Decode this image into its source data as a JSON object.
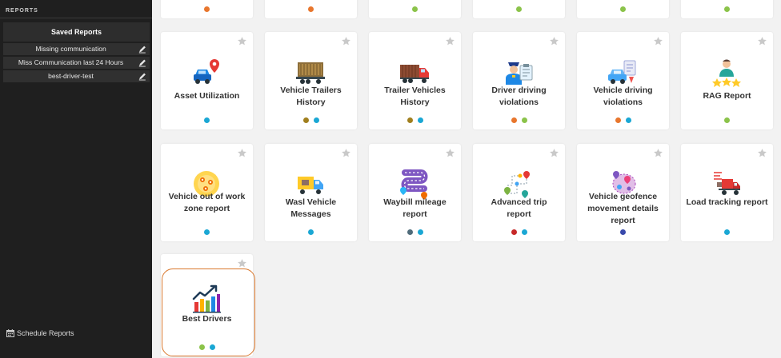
{
  "sidebar": {
    "header": "REPORTS",
    "saved_title": "Saved Reports",
    "saved_items": [
      {
        "label": "Missing communication"
      },
      {
        "label": "Miss Communication last 24 Hours"
      },
      {
        "label": "best-driver-test"
      }
    ],
    "schedule_label": "Schedule Reports"
  },
  "colors": {
    "orange": "#e8762d",
    "green": "#8bc34a",
    "cyan": "#1aa7d4",
    "olive": "#a07f1e",
    "red": "#c62828",
    "slate": "#4f6b7a",
    "navy": "#3949ab",
    "highlight": "#d9772c"
  },
  "reports": [
    {
      "title": "",
      "icon": "none",
      "dots": [
        "orange"
      ]
    },
    {
      "title": "",
      "icon": "none",
      "dots": [
        "orange"
      ]
    },
    {
      "title": "",
      "icon": "none",
      "dots": [
        "green"
      ]
    },
    {
      "title": "",
      "icon": "none",
      "dots": [
        "green"
      ]
    },
    {
      "title": "",
      "icon": "none",
      "dots": [
        "green"
      ]
    },
    {
      "title": "",
      "icon": "none",
      "dots": [
        "green"
      ]
    },
    {
      "title": "Asset Utilization",
      "icon": "car-location-icon",
      "dots": [
        "cyan"
      ]
    },
    {
      "title": "Vehicle Trailers History",
      "icon": "trailer-icon",
      "dots": [
        "olive",
        "cyan"
      ]
    },
    {
      "title": "Trailer Vehicles History",
      "icon": "truck-icon",
      "dots": [
        "olive",
        "cyan"
      ]
    },
    {
      "title": "Driver driving violations",
      "icon": "police-icon",
      "dots": [
        "orange",
        "green"
      ]
    },
    {
      "title": "Vehicle driving violations",
      "icon": "violation-car-icon",
      "dots": [
        "orange",
        "cyan"
      ]
    },
    {
      "title": "RAG Report",
      "icon": "rating-icon",
      "dots": [
        "green"
      ]
    },
    {
      "title": "Vehicle out of work zone report",
      "icon": "zone-icon",
      "dots": [
        "cyan"
      ]
    },
    {
      "title": "Wasl Vehicle Messages",
      "icon": "delivery-truck-icon",
      "dots": [
        "cyan"
      ]
    },
    {
      "title": "Waybill mileage report",
      "icon": "road-icon",
      "dots": [
        "slate",
        "cyan"
      ]
    },
    {
      "title": "Advanced trip report",
      "icon": "route-icon",
      "dots": [
        "red",
        "cyan"
      ]
    },
    {
      "title": "Vehicle geofence movement details report",
      "icon": "geofence-icon",
      "dots": [
        "navy"
      ]
    },
    {
      "title": "Load tracking report",
      "icon": "load-truck-icon",
      "dots": [
        "cyan"
      ]
    },
    {
      "title": "Best Drivers",
      "icon": "growth-chart-icon",
      "dots": [
        "green",
        "cyan"
      ]
    }
  ]
}
